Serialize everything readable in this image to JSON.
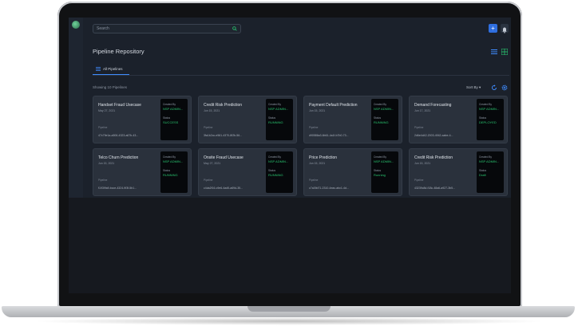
{
  "search": {
    "placeholder": "Search"
  },
  "header": {
    "add_label": "+",
    "title": "Pipeline Repository"
  },
  "tabs": [
    {
      "label": "All Pipelines"
    }
  ],
  "toolbar": {
    "showing": "Showing 10 Pipelines",
    "sort_label": "Sort By ▾"
  },
  "colors": {
    "accent": "#2f6fe0",
    "status_green": "#29c46f",
    "background": "#1b212b",
    "card": "#2a313c"
  },
  "cards_meta": {
    "created_by_label": "Created By",
    "status_label": "Status",
    "pipeline_label": "Pipeline"
  },
  "cards": [
    {
      "name": "Handset Fraud Usecase",
      "date": "May 27, 2021",
      "id": "47c79e1a-a506-4323-a67b-43...",
      "created_by": "NSP ADMIN...",
      "status": "SUCCESS"
    },
    {
      "name": "Credit Risk Prediction",
      "date": "Jun 15, 2021",
      "id": "3fa1b2cc-e561-4370-8f2b-56...",
      "created_by": "NSP ADMIN...",
      "status": "RUNNING"
    },
    {
      "name": "Payment Default Prediction",
      "date": "Jun 15, 2021",
      "id": "d90586a3-6b61-4a1f-b7b0-73...",
      "created_by": "NSP ADMIN...",
      "status": "RUNNING"
    },
    {
      "name": "Demand Forecasting",
      "date": "Jun 17, 2021",
      "id": "2d6e4d42-2003-4942-aabe-4...",
      "created_by": "NSP ADMIN...",
      "status": "DEPLOYED"
    },
    {
      "name": "Telco Churn Prediction",
      "date": "Jun 15, 2021",
      "id": "f1939fa9-bcce-4324-9f3f-5b1...",
      "created_by": "NSP ADMIN...",
      "status": "RUNNING"
    },
    {
      "name": "Onsite Fraud Usecase",
      "date": "May 27, 2021",
      "id": "c4da2f16-c9e6-4ad5-a69d-35...",
      "created_by": "NSP ADMIN...",
      "status": "RUNNING"
    },
    {
      "name": "Price Prediction",
      "date": "Jun 15, 2021",
      "id": "c7a39d71-2310-4eac-abc1-4d...",
      "created_by": "NSP ADMIN...",
      "status": "Running"
    },
    {
      "name": "Credit Risk Prediction",
      "date": "Jun 15, 2021",
      "id": "43239c8d-f18c-48a6-a927-3b5...",
      "created_by": "NSP ADMIN...",
      "status": "Draft"
    }
  ]
}
